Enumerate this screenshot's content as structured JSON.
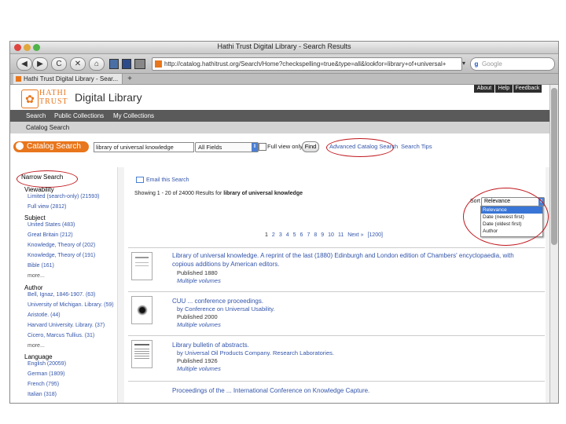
{
  "window": {
    "title": "Hathi Trust Digital Library - Search Results"
  },
  "toolbar": {
    "back": "◀",
    "forward": "▶",
    "reload": "C",
    "stop": "✕",
    "home": "⌂",
    "url": "http://catalog.hathitrust.org/Search/Home?checkspelling=true&type=all&lookfor=library+of+universal+",
    "search_placeholder": "Google"
  },
  "tab": {
    "label": "Hathi Trust Digital Library - Sear...",
    "new_tab": "+"
  },
  "header": {
    "logo_top": "HATHI",
    "logo_bottom": "TRUST",
    "site_name": "Digital Library",
    "top_links": [
      "About",
      "Help",
      "Feedback"
    ]
  },
  "nav": {
    "items": [
      "Search",
      "Public Collections",
      "My Collections"
    ]
  },
  "subnav": {
    "label": "Catalog Search"
  },
  "search": {
    "badge": "Catalog Search",
    "query": "library of universal knowledge",
    "field": "All Fields",
    "full_view": "Full view only",
    "find": "Find",
    "advanced": "Advanced Catalog Search",
    "tips": "Search Tips"
  },
  "sidebar": {
    "heading": "Narrow Search",
    "viewability": "Viewability",
    "viewability_items": [
      "Limited (search-only) (21593)",
      "Full view (2812)"
    ],
    "subject": "Subject",
    "subject_items": [
      "United States (483)",
      "Great Britain (212)",
      "Knowledge, Theory of (202)",
      "Knowledge, Theory of (191)",
      "Bible (161)",
      "more..."
    ],
    "author": "Author",
    "author_items": [
      "Bell, Ignaz, 1846-1907. (63)",
      "University of Michigan. Library. (59)",
      "Aristotle. (44)",
      "Harvard University. Library. (37)",
      "Cicero, Marcus Tullius. (31)",
      "more..."
    ],
    "language": "Language",
    "language_items": [
      "English (20059)",
      "German (1809)",
      "French (795)",
      "Italian (318)"
    ]
  },
  "results": {
    "email": "Email this Search",
    "showing_prefix": "Showing 1 - 20 of 24000 Results for",
    "showing_query": "library of universal knowledge",
    "sort_label": "Sort",
    "sort_selected": "Relevance",
    "sort_options": [
      "Relevance",
      "Date (newest first)",
      "Date (oldest first)",
      "Author"
    ],
    "pages": [
      "1",
      "2",
      "3",
      "4",
      "5",
      "6",
      "7",
      "8",
      "9",
      "10",
      "11"
    ],
    "next": "Next »",
    "last": "[1200]",
    "items": [
      {
        "title": "Library of universal knowledge. A reprint of the last (1880) Edinburgh and London edition of Chambers' encyclopaedia, with",
        "title2": "copious additions by American editors.",
        "by": "",
        "published": "Published 1880",
        "link": "Multiple volumes"
      },
      {
        "title": "CUU ... conference proceedings.",
        "title2": "",
        "by": "by Conference on Universal Usability.",
        "published": "Published 2000",
        "link": "Multiple volumes"
      },
      {
        "title": "Library bulletin of abstracts.",
        "title2": "",
        "by": "by Universal Oil Products Company. Research Laboratories.",
        "published": "Published 1926",
        "link": "Multiple volumes"
      },
      {
        "title": "Proceedings of the ... International Conference on Knowledge Capture.",
        "title2": "",
        "by": "",
        "published": "",
        "link": ""
      }
    ]
  }
}
